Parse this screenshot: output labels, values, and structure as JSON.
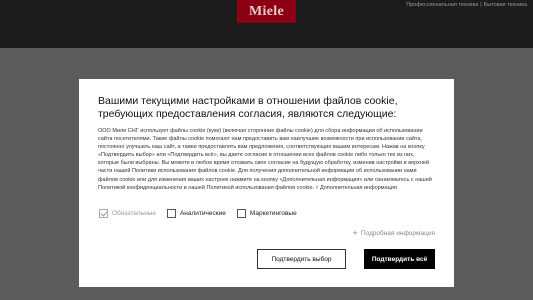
{
  "header": {
    "logo_text": "Miele",
    "nav": {
      "professional": "Профессиональная техника",
      "separator": "|",
      "household": "Бытовая техника"
    }
  },
  "consent": {
    "title": "Вашими текущими настройками в отношении файлов cookie, требующих предоставления согласия, являются следующие:",
    "description": "ООО Миле СНГ использует файлы cookie (куки) (включая сторонние файлы cookie) для сбора информации об использовании сайта посетителями. Такие файлы cookie помогают нам предоставить вам наилучшие возможности при использовании сайта, постоянно улучшать наш сайт, а также предоставлять вам предложения, соответствующие вашим интересам. Нажав на кнопку «Подтвердить выбор» или «Подтвердить всё», вы даете согласие в отношении всех файлов cookie либо только тех из них, которые были выбраны. Вы можете в любое время отозвать свое согласие на будущую обработку, изменив настройки в верхней части нашей Политики использования файлов cookie. Для получения дополнительной информации об использовании нами файлов cookie или для изменения ваших настроек нажмите на кнопку «Дополнительная информация» или ознакомьтесь с нашей Политикой конфиденциальности и нашей Политикой использования файлов cookie.",
    "more_link": "Дополнительная информация",
    "checkboxes": {
      "required": {
        "label": "Обязательные",
        "checked": true,
        "disabled": true
      },
      "analytics": {
        "label": "Аналитические",
        "checked": false
      },
      "marketing": {
        "label": "Маркетинговые",
        "checked": false
      }
    },
    "details_toggle": "Подробная информация",
    "confirm_selection": "Подтвердить выбор",
    "confirm_all": "Подтвердить всё"
  },
  "colors": {
    "brand": "#8c0014",
    "overlay": "#5c5c5c",
    "primary_button": "#000000"
  }
}
